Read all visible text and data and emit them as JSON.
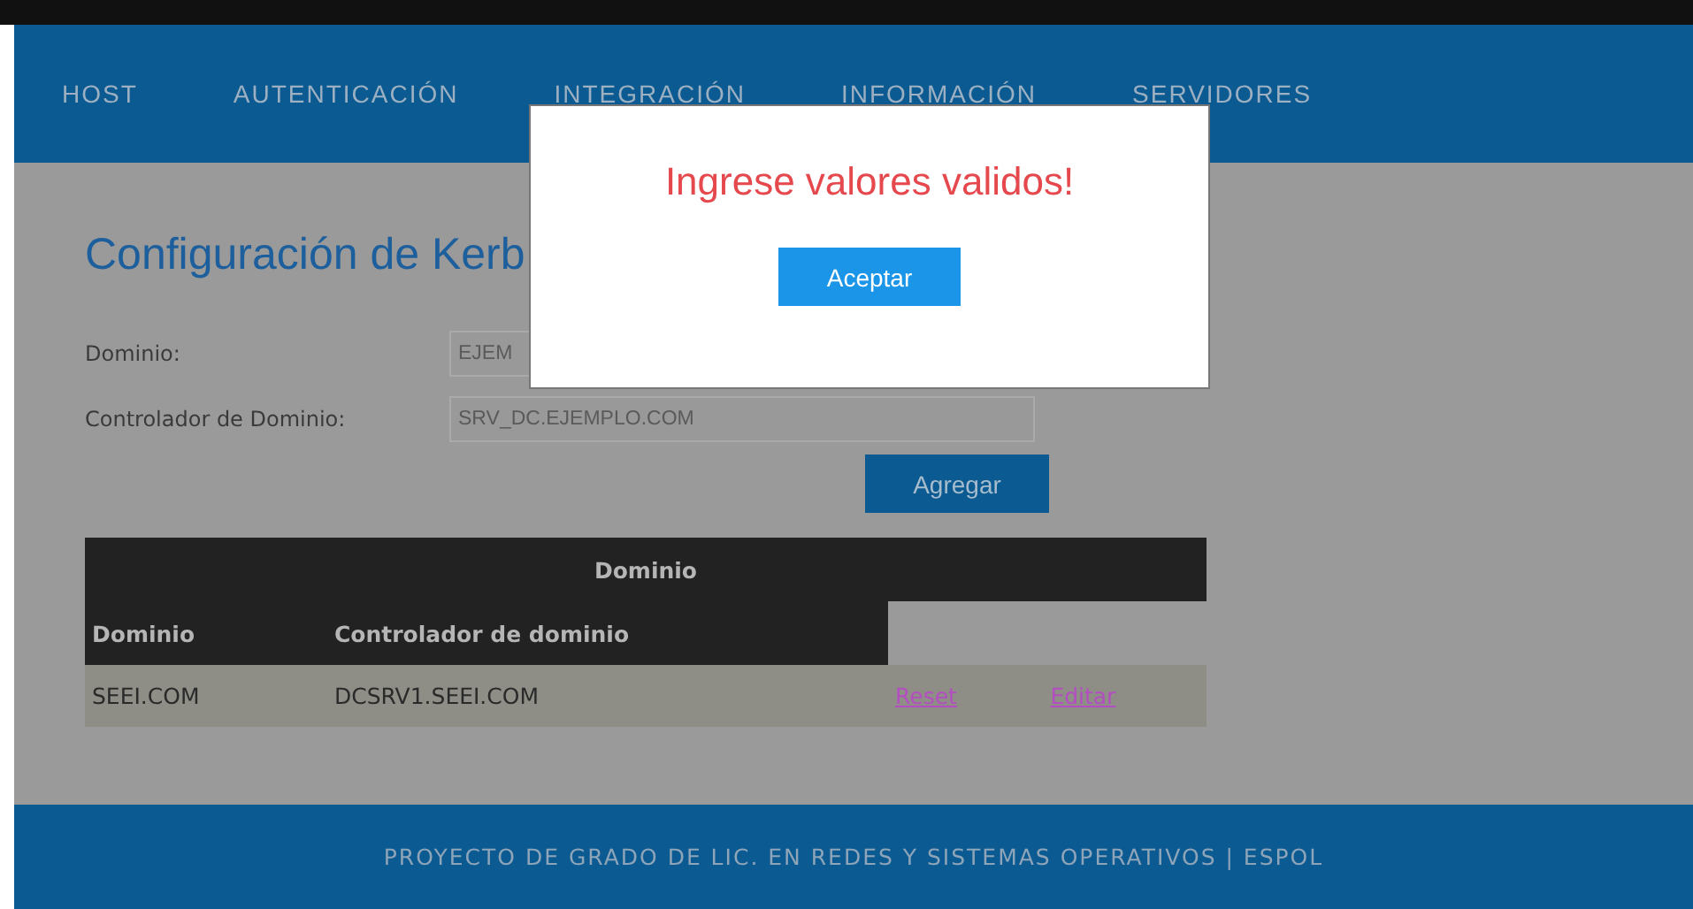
{
  "nav": {
    "items": [
      "HOST",
      "AUTENTICACIÓN",
      "INTEGRACIÓN",
      "INFORMACIÓN",
      "SERVIDORES"
    ]
  },
  "page": {
    "title": "Configuración de Kerb"
  },
  "form": {
    "fields": [
      {
        "label": "Dominio:",
        "value": "EJEM"
      },
      {
        "label": "Controlador de Dominio:",
        "value": "SRV_DC.EJEMPLO.COM"
      }
    ],
    "button": "Agregar"
  },
  "table": {
    "group_header": "Dominio",
    "columns": [
      "Dominio",
      "Controlador de dominio"
    ],
    "rows": [
      {
        "cells": [
          "SEEI.COM",
          "DCSRV1.SEEI.COM"
        ],
        "links": [
          "Reset",
          "Editar"
        ]
      }
    ]
  },
  "footer": {
    "text": "PROYECTO DE GRADO DE LIC. EN REDES Y SISTEMAS OPERATIVOS | ESPOL"
  },
  "modal": {
    "message": "Ingrese valores validos!",
    "button": "Aceptar"
  }
}
